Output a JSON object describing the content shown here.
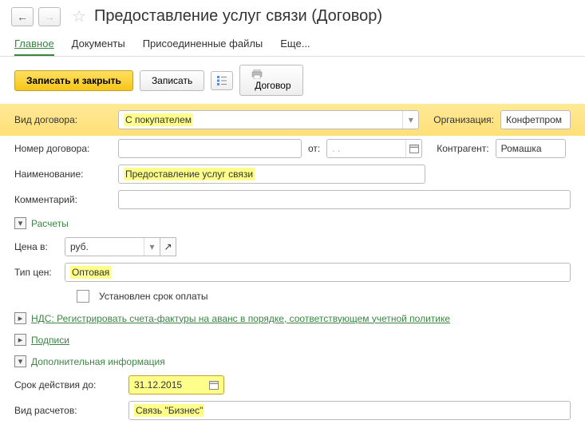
{
  "header": {
    "title": "Предоставление услуг связи (Договор)"
  },
  "tabs": {
    "main": "Главное",
    "documents": "Документы",
    "attachments": "Присоединенные файлы",
    "more": "Еще..."
  },
  "toolbar": {
    "save_close": "Записать и закрыть",
    "save": "Записать",
    "contract": "Договор"
  },
  "fields": {
    "contract_type_label": "Вид договора:",
    "contract_type_value": "С покупателем",
    "org_label": "Организация:",
    "org_value": "Конфетпром",
    "contract_no_label": "Номер договора:",
    "contract_no_value": "",
    "from_label": "от:",
    "from_value": ".  .",
    "counterparty_label": "Контрагент:",
    "counterparty_value": "Ромашка",
    "name_label": "Наименование:",
    "name_value": "Предоставление услуг связи",
    "comment_label": "Комментарий:",
    "comment_value": ""
  },
  "sections": {
    "payments": "Расчеты",
    "vat": "НДС: Регистрировать счета-фактуры на аванс в порядке, соответствующем учетной политике",
    "signatures": "Подписи",
    "additional": "Дополнительная информация"
  },
  "payments": {
    "price_in_label": "Цена в:",
    "price_in_value": "руб.",
    "price_type_label": "Тип цен:",
    "price_type_value": "Оптовая",
    "due_set_label": "Установлен срок оплаты"
  },
  "additional": {
    "valid_until_label": "Срок действия до:",
    "valid_until_value": "31.12.2015",
    "settlement_type_label": "Вид расчетов:",
    "settlement_type_value": "Связь \"Бизнес\""
  }
}
